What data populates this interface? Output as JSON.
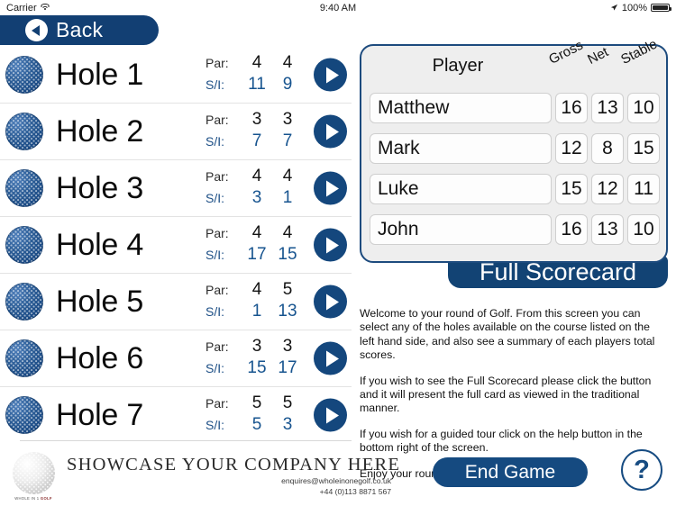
{
  "status_bar": {
    "carrier": "Carrier",
    "wifi_icon": "wifi-icon",
    "time": "9:40 AM",
    "location_icon": "location-arrow-icon",
    "battery_percent": "100%",
    "battery_icon": "battery-full-icon"
  },
  "nav": {
    "back_label": "Back",
    "back_icon": "back-chevron-circle-icon"
  },
  "hole_list": {
    "par_label": "Par:",
    "si_label": "S/I:",
    "ball_icon": "golf-ball-icon",
    "play_icon": "play-arrow-icon",
    "holes": [
      {
        "name": "Hole 1",
        "par": [
          "4",
          "4"
        ],
        "si": [
          "11",
          "9"
        ]
      },
      {
        "name": "Hole 2",
        "par": [
          "3",
          "3"
        ],
        "si": [
          "7",
          "7"
        ]
      },
      {
        "name": "Hole 3",
        "par": [
          "4",
          "4"
        ],
        "si": [
          "3",
          "1"
        ]
      },
      {
        "name": "Hole 4",
        "par": [
          "4",
          "4"
        ],
        "si": [
          "17",
          "15"
        ]
      },
      {
        "name": "Hole 5",
        "par": [
          "4",
          "5"
        ],
        "si": [
          "1",
          "13"
        ]
      },
      {
        "name": "Hole 6",
        "par": [
          "3",
          "3"
        ],
        "si": [
          "15",
          "17"
        ]
      },
      {
        "name": "Hole 7",
        "par": [
          "5",
          "5"
        ],
        "si": [
          "5",
          "3"
        ]
      }
    ]
  },
  "scorecard": {
    "headers": {
      "player": "Player",
      "gross": "Gross",
      "net": "Net",
      "stable": "Stable"
    },
    "rows": [
      {
        "player": "Matthew",
        "gross": "16",
        "net": "13",
        "stable": "10"
      },
      {
        "player": "Mark",
        "gross": "12",
        "net": "8",
        "stable": "15"
      },
      {
        "player": "Luke",
        "gross": "15",
        "net": "12",
        "stable": "11"
      },
      {
        "player": "John",
        "gross": "16",
        "net": "13",
        "stable": "10"
      }
    ],
    "full_scorecard_label": "Full Scorecard"
  },
  "info": {
    "p1": "Welcome to your round of Golf. From this screen you can select any of the holes available on the course listed on the left hand side, and also see a summary of each players total scores.",
    "p2": "If you wish to see the Full Scorecard please click the button and it will present the full card as viewed in the traditional manner.",
    "p3": "If you wish for a guided tour click on the help button in the bottom right of the screen.",
    "p4": "Enjoy your round."
  },
  "footer": {
    "ad_logo_icon": "golf-ball-logo-icon",
    "ad_logo_text_a": "WHOLE IN 1 ",
    "ad_logo_text_b": "GOLF",
    "ad_headline": "SHOWCASE YOUR COMPANY HERE",
    "ad_email": "enquires@wholeinonegolf.co.uk",
    "ad_phone": "+44 (0)113 8871 567",
    "end_game_label": "End Game",
    "help_label": "?"
  },
  "colors": {
    "navy": "#14477d",
    "navy_dark": "#123f73",
    "si_blue": "#17548f",
    "panel_bg": "#eeeeee",
    "panel_border": "#1d4b7e"
  }
}
